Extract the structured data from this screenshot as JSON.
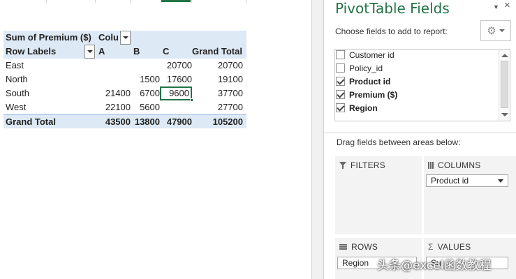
{
  "pivot": {
    "header": {
      "value_label": "Sum of Premium ($)",
      "columns_label": "Colu"
    },
    "subheader": {
      "row_labels": "Row Labels",
      "cols": [
        "A",
        "B",
        "C"
      ],
      "grand_total": "Grand Total"
    },
    "rows": [
      {
        "label": "East",
        "a": "",
        "b": "",
        "c": "20700",
        "total": "20700"
      },
      {
        "label": "North",
        "a": "",
        "b": "1500",
        "c": "17600",
        "total": "19100"
      },
      {
        "label": "South",
        "a": "21400",
        "b": "6700",
        "c": "9600",
        "total": "37700"
      },
      {
        "label": "West",
        "a": "22100",
        "b": "5600",
        "c": "",
        "total": "27700"
      }
    ],
    "total_row": {
      "label": "Grand Total",
      "a": "43500",
      "b": "13800",
      "c": "47900",
      "total": "105200"
    },
    "selected_cell_value": "9600"
  },
  "pane": {
    "title": "PivotTable Fields",
    "choose_label": "Choose fields to add to report:",
    "close_glyph": "×",
    "options_glyph": "▼",
    "gear_glyph": "⚙",
    "fields": [
      {
        "name": "Customer id",
        "checked": false
      },
      {
        "name": "Policy_id",
        "checked": false
      },
      {
        "name": "Product id",
        "checked": true
      },
      {
        "name": "Premium ($)",
        "checked": true
      },
      {
        "name": "Region",
        "checked": true
      }
    ],
    "drag_label": "Drag fields between areas below:",
    "areas": {
      "filters": {
        "title": "FILTERS"
      },
      "columns": {
        "title": "COLUMNS",
        "chip": "Product id"
      },
      "rows": {
        "title": "ROWS",
        "chip": "Region"
      },
      "values": {
        "title": "VALUES",
        "chip": "Su"
      }
    },
    "values_icon_glyph": "Σ"
  },
  "watermark": "头条@excel函数教程",
  "colors": {
    "accent": "#217346",
    "pivot_header_bg": "#dde9f5",
    "area_bg": "#f3f3f3"
  }
}
